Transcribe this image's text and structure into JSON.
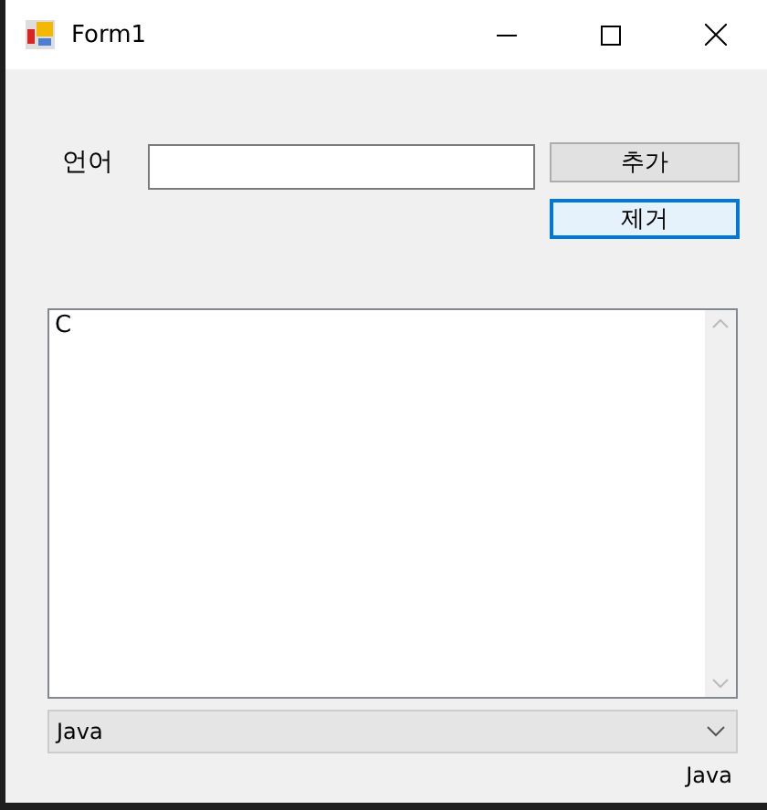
{
  "window": {
    "title": "Form1"
  },
  "language_label": "언어",
  "buttons": [
    {
      "label": "추가",
      "focused": false
    },
    {
      "label": "제거",
      "focused": true
    }
  ],
  "list_items": [
    {
      "text": "C",
      "selected": false
    }
  ],
  "combo": {
    "value": "Java"
  },
  "result_label": "Java"
}
